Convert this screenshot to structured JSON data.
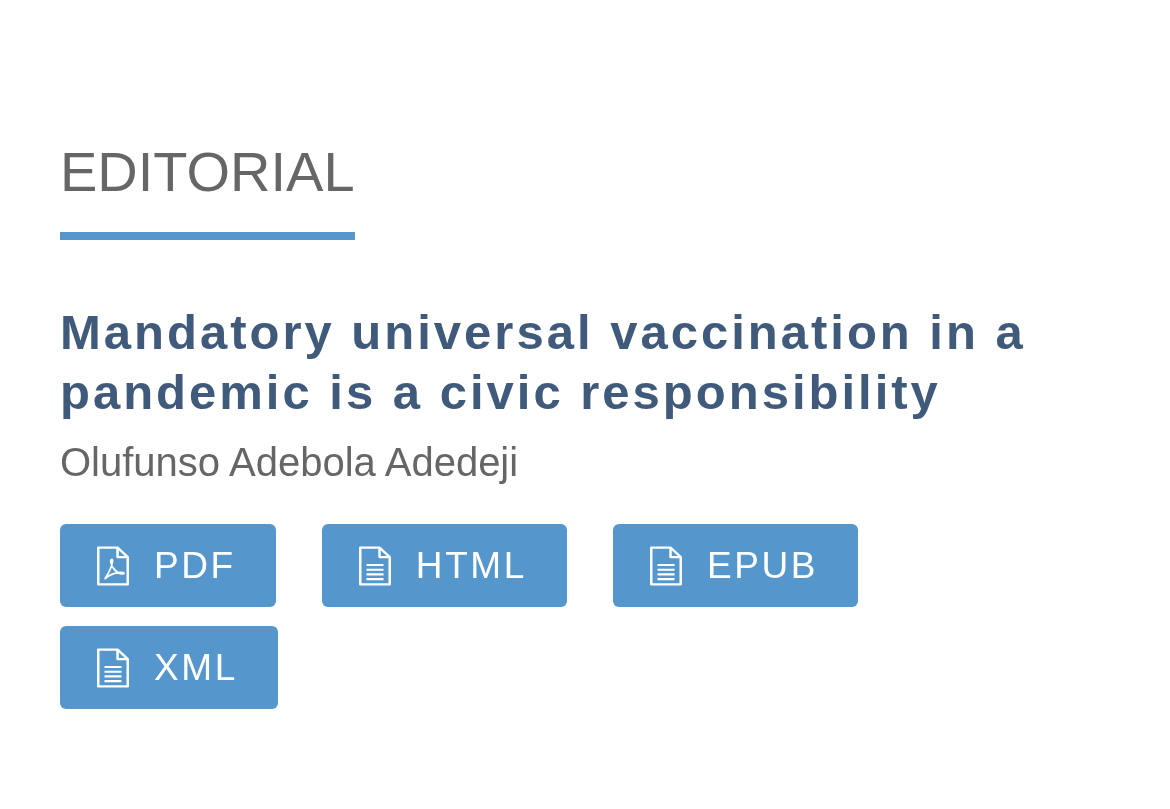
{
  "section": {
    "label": "EDITORIAL"
  },
  "article": {
    "title": "Mandatory universal vaccination in a pandemic is a civic responsibility",
    "author": "Olufunso Adebola Adedeji"
  },
  "downloads": [
    {
      "label": "PDF",
      "kind": "pdf"
    },
    {
      "label": "HTML",
      "kind": "document"
    },
    {
      "label": "EPUB",
      "kind": "document"
    },
    {
      "label": "XML",
      "kind": "document"
    }
  ]
}
